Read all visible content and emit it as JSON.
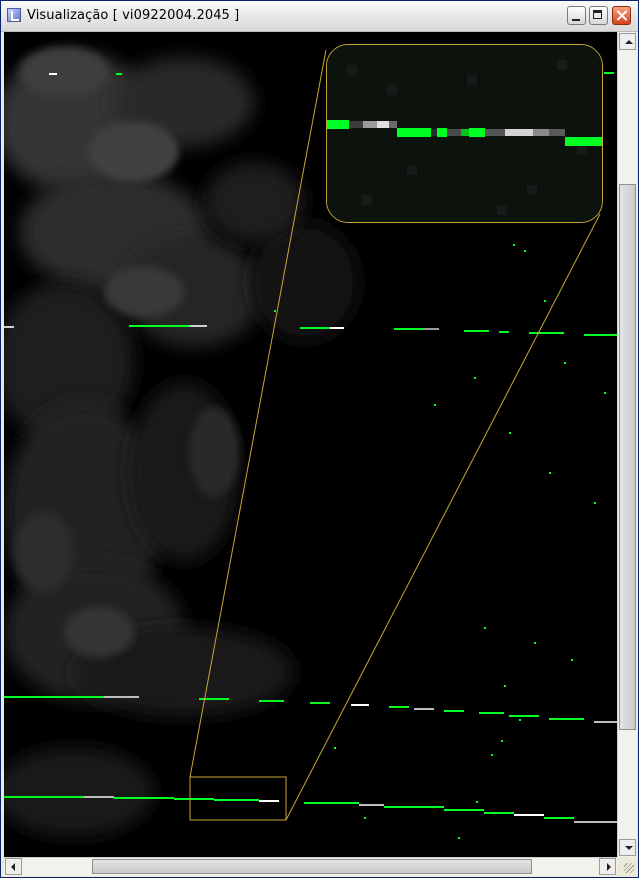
{
  "window": {
    "title": "Visualização [ vi0922004.2045 ]",
    "buttons": [
      "minimize",
      "maximize",
      "close"
    ]
  },
  "colors": {
    "title_bar": "#e6e6e6",
    "image_background": "#000000",
    "line_green": "#00ff22",
    "line_white": "#ffffff",
    "highlight_gold": "#c7a53a"
  },
  "viewer": {
    "content": "satellite-image",
    "zoom_inset": true
  },
  "scrollbars": {
    "vertical": {
      "position": 0.18
    },
    "horizontal": {
      "position": 0.14
    }
  }
}
